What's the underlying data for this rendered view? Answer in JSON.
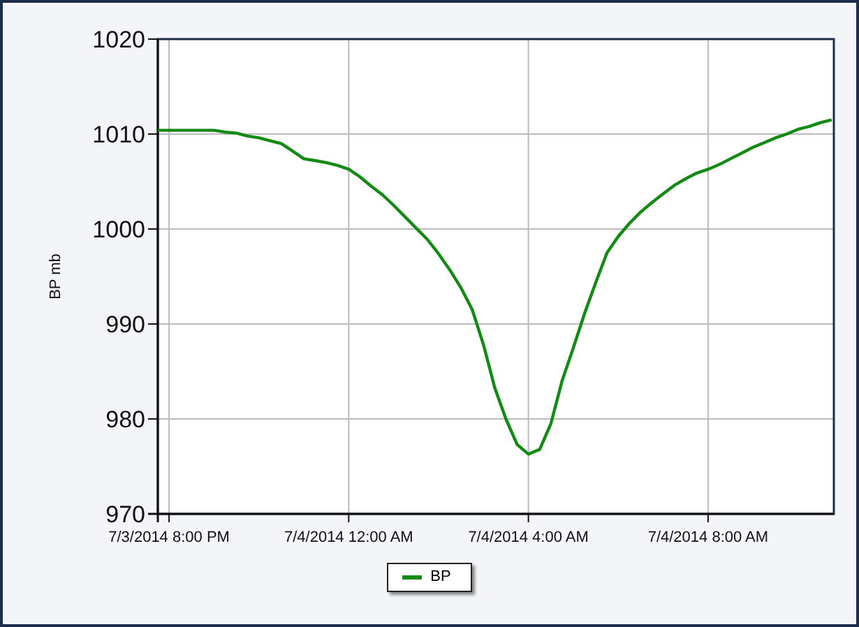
{
  "chart": {
    "chart_data": {
      "type": "line",
      "grid": true,
      "ylabel": "BP mb",
      "categories": [
        null,
        "7/3/2014 8:00 PM",
        null,
        null,
        null,
        null,
        null,
        null,
        null,
        null,
        null,
        null,
        null,
        null,
        null,
        null,
        null,
        "7/4/2014 12:00 AM",
        null,
        null,
        null,
        null,
        null,
        null,
        null,
        null,
        null,
        null,
        null,
        null,
        null,
        null,
        null,
        "7/4/2014 4:00 AM",
        null,
        null,
        null,
        null,
        null,
        null,
        null,
        null,
        null,
        null,
        null,
        null,
        null,
        null,
        null,
        "7/4/2014 8:00 AM",
        null,
        null,
        null,
        null,
        null,
        null,
        null,
        null,
        null,
        null,
        null
      ],
      "series": [
        {
          "name": "BP",
          "color": "#138a13",
          "values": [
            1010.4,
            1010.4,
            1010.4,
            1010.4,
            1010.4,
            1010.4,
            1010.2,
            1010.1,
            1009.8,
            1009.6,
            1009.3,
            1009.0,
            1008.2,
            1007.4,
            1007.2,
            1007.0,
            1006.7,
            1006.3,
            1005.5,
            1004.5,
            1003.6,
            1002.5,
            1001.3,
            1000.1,
            998.9,
            997.4,
            995.7,
            993.8,
            991.5,
            987.8,
            983.3,
            980.0,
            977.3,
            976.3,
            976.8,
            979.5,
            984.0,
            987.5,
            991.1,
            994.4,
            997.5,
            999.2,
            1000.6,
            1001.8,
            1002.8,
            1003.7,
            1004.6,
            1005.3,
            1005.9,
            1006.3,
            1006.8,
            1007.4,
            1008.0,
            1008.6,
            1009.1,
            1009.6,
            1010.0,
            1010.5,
            1010.8,
            1011.2,
            1011.5
          ]
        }
      ],
      "ylim": [
        970,
        1020
      ],
      "yticks": [
        970,
        980,
        990,
        1000,
        1010,
        1020
      ]
    }
  }
}
